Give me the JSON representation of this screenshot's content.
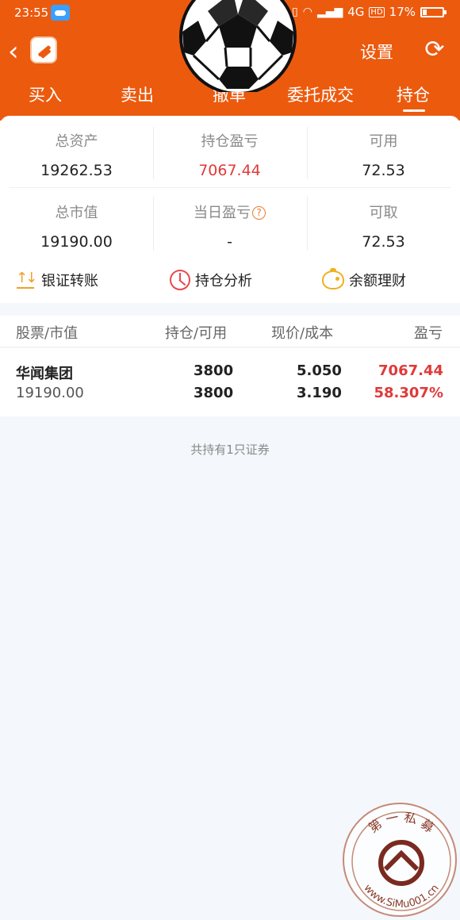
{
  "status": {
    "time": "23:55",
    "network": "4G",
    "hd": "HD",
    "battery": "17%"
  },
  "nav": {
    "settings_label": "设置"
  },
  "tabs": [
    "买入",
    "卖出",
    "撤单",
    "委托成交",
    "持仓"
  ],
  "active_tab": "持仓",
  "summary": {
    "total_assets_label": "总资产",
    "total_assets": "19262.53",
    "position_pl_label": "持仓盈亏",
    "position_pl": "7067.44",
    "available_label": "可用",
    "available": "72.53",
    "market_value_label": "总市值",
    "market_value": "19190.00",
    "daily_pl_label": "当日盈亏",
    "daily_pl": "-",
    "withdrawable_label": "可取",
    "withdrawable": "72.53"
  },
  "actions": {
    "transfer": "银证转账",
    "analysis": "持仓分析",
    "wealth": "余额理财"
  },
  "table": {
    "headers": [
      "股票/市值",
      "持仓/可用",
      "现价/成本",
      "盈亏"
    ],
    "rows": [
      {
        "name": "华闻集团",
        "market_value": "19190.00",
        "holding": "3800",
        "available": "3800",
        "price": "5.050",
        "cost": "3.190",
        "pl": "7067.44",
        "pl_pct": "58.307%"
      }
    ]
  },
  "footer_note": "共持有1只证券",
  "watermark": {
    "top_text": "第 一 私 募",
    "bottom_text": "www.SiMu001.cn"
  },
  "colors": {
    "brand": "#ec5a0e",
    "profit_red": "#e03a3a"
  }
}
